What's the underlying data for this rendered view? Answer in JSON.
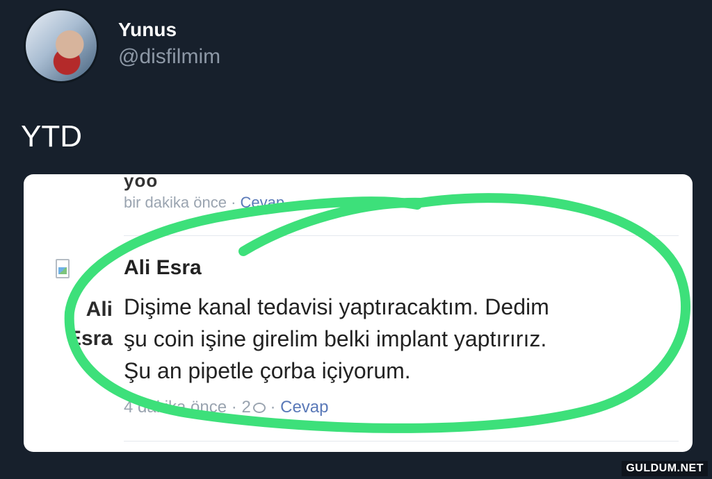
{
  "tweet": {
    "display_name": "Yunus",
    "handle": "@disfilmim",
    "text": "YTD"
  },
  "embedded_comment": {
    "partial_text_top": "yoo",
    "meta_top": {
      "time": "bir dakika önce",
      "separator": " · ",
      "reply": "Cevap"
    },
    "commenter_name": "Ali Esra",
    "avatar_alt_text": [
      "Ali",
      "Esra"
    ],
    "body_lines": [
      "Dişime kanal tedavisi yaptıracaktım. Dedim",
      "şu coin işine girelim belki implant yaptırırız.",
      "Şu an pipetle çorba içiyorum."
    ],
    "meta_bottom": {
      "time": "4 dakika önce",
      "separator": " · ",
      "reply_count": "2",
      "reply": "Cevap"
    }
  },
  "watermark": "GULDUM.NET",
  "colors": {
    "background": "#17202c",
    "highlight": "#3de07a",
    "link": "#5a79b8"
  }
}
